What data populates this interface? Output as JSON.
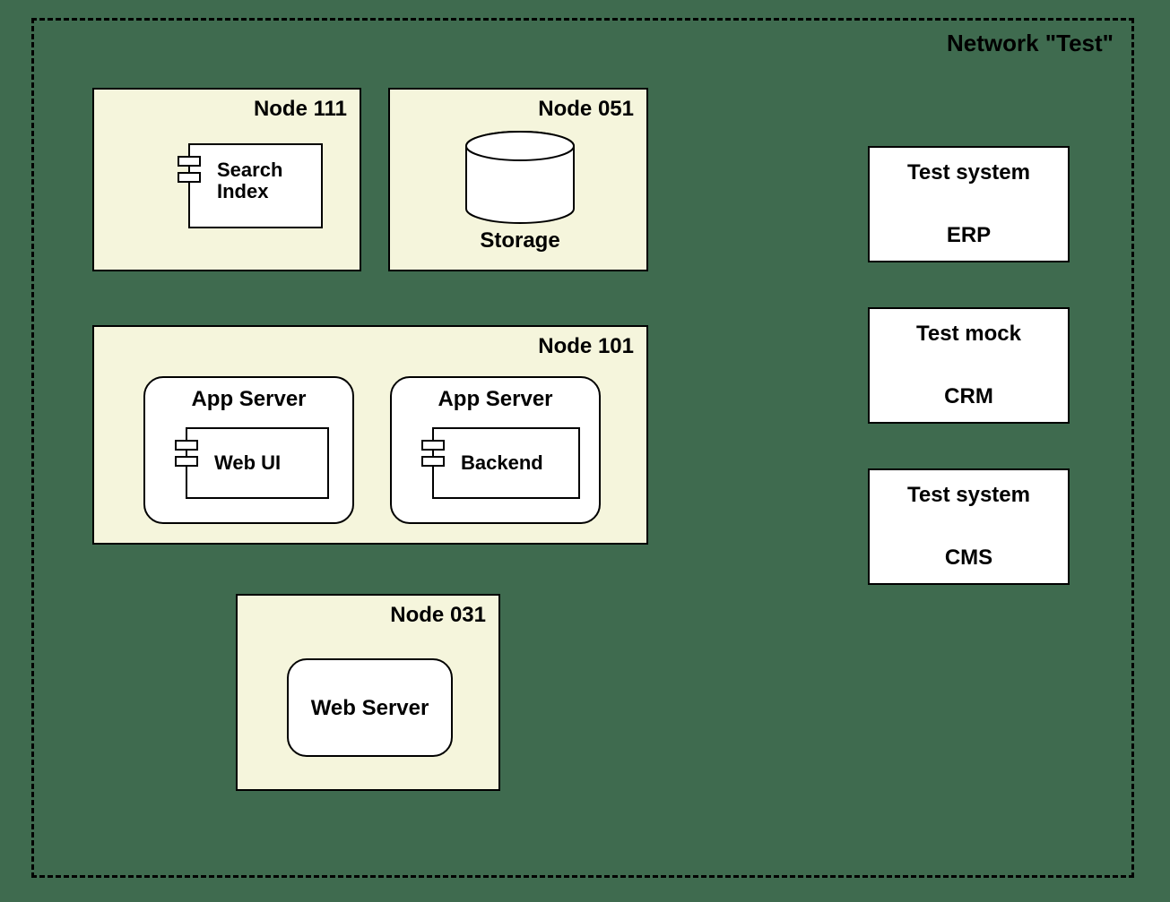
{
  "network": {
    "title": "Network \"Test\""
  },
  "nodes": {
    "n111": {
      "title": "Node 111",
      "component": "Search\nIndex"
    },
    "n051": {
      "title": "Node 051",
      "storage": "Storage"
    },
    "n101": {
      "title": "Node 101",
      "app1": {
        "server": "App Server",
        "component": "Web UI"
      },
      "app2": {
        "server": "App Server",
        "component": "Backend"
      }
    },
    "n031": {
      "title": "Node 031",
      "server": "Web Server"
    }
  },
  "ext": {
    "erp": {
      "line1": "Test system",
      "line2": "ERP"
    },
    "crm": {
      "line1": "Test mock",
      "line2": "CRM"
    },
    "cms": {
      "line1": "Test system",
      "line2": "CMS"
    }
  }
}
